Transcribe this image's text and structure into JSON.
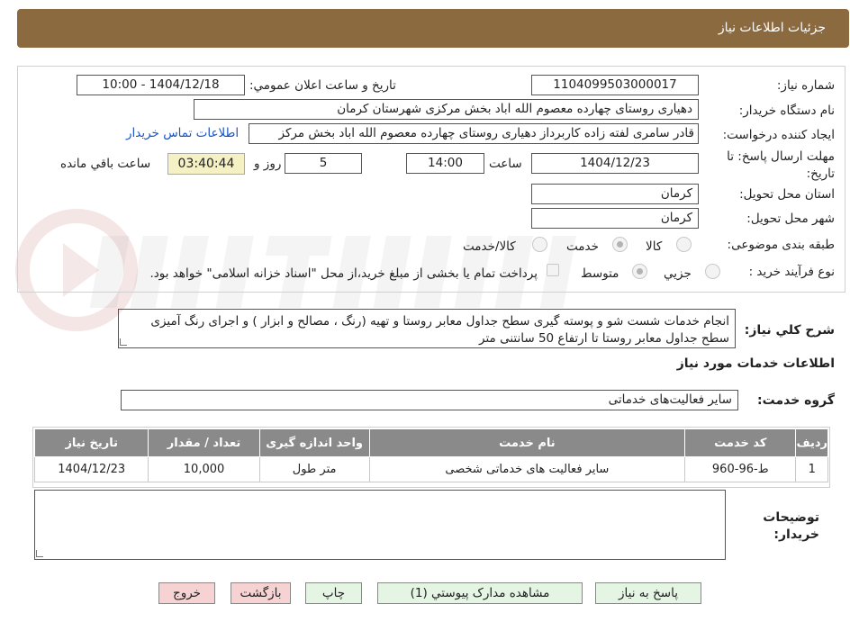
{
  "header": {
    "title": "جزئیات اطلاعات نیاز"
  },
  "fields": {
    "need_number_label": "شماره نیاز:",
    "need_number": "1104099503000017",
    "announce_label": "تاریخ و ساعت اعلان عمومي:",
    "announce_value": "1404/12/18 - 10:00",
    "buyer_org_label": "نام دستگاه خريدار:",
    "buyer_org": "دهیاری روستای چهارده معصوم الله اباد بخش مرکزی شهرستان کرمان",
    "creator_label": "ايجاد کننده درخواست:",
    "creator": "قادر سامری لفته زاده کاربرداز دهیاری روستای چهارده معصوم الله اباد بخش مرکز",
    "contact_link": "اطلاعات تماس خريدار",
    "deadline_label_1": "مهلت ارسال پاسخ: تا",
    "deadline_label_2": "تاريخ:",
    "deadline_date": "1404/12/23",
    "time_label": "ساعت",
    "deadline_time": "14:00",
    "days": "5",
    "days_label": "روز و",
    "remaining_time": "03:40:44",
    "remaining_label": "ساعت باقي مانده",
    "province_label": "استان محل تحويل:",
    "province": "کرمان",
    "city_label": "شهر محل تحويل:",
    "city": "کرمان",
    "category_label": "طبقه بندی موضوعی:",
    "category_options": [
      "کالا",
      "خدمت",
      "کالا/خدمت"
    ],
    "category_selected": "خدمت",
    "process_label": "نوع فرآيند خريد :",
    "process_options": [
      "جزيي",
      "متوسط"
    ],
    "process_selected": "متوسط",
    "payment_note": "پرداخت تمام يا بخشی از مبلغ خريد،از محل \"اسناد خزانه اسلامی\" خواهد بود."
  },
  "description": {
    "label": "شرح کلي نياز:",
    "text": "انجام خدمات شست شو و پوسته گیری سطح جداول معابر روستا  و تهیه (رنگ ، مصالح و ابزار )  و اجرای رنگ آمیزی سطح جداول معابر روستا تا ارتفاع 50 سانتنی متر"
  },
  "services": {
    "section_title": "اطلاعات خدمات مورد نياز",
    "group_label": "گروه خدمت:",
    "group_value": "ساير فعاليت‌های خدماتی",
    "columns": [
      "رديف",
      "کد خدمت",
      "نام خدمت",
      "واحد اندازه گيری",
      "تعداد / مقدار",
      "تاريخ نياز"
    ],
    "rows": [
      [
        "1",
        "ط-96-960",
        "سایر فعالیت های خدماتی شخصی",
        "متر طول",
        "10,000",
        "1404/12/23"
      ]
    ]
  },
  "notes": {
    "label_1": "توضيحات",
    "label_2": "خريدار:"
  },
  "buttons": {
    "reply": "پاسخ به نياز",
    "attachments": "مشاهده مدارک پيوستي (1)",
    "print": "چاپ",
    "back": "بازگشت",
    "exit": "خروج"
  },
  "colors": {
    "header": "#8b6a3f",
    "table_header": "#8a8a8a",
    "time_box": "#f5f1c4",
    "exit_button": "#f7d2d2",
    "normal_button": "#e4f5e4"
  }
}
